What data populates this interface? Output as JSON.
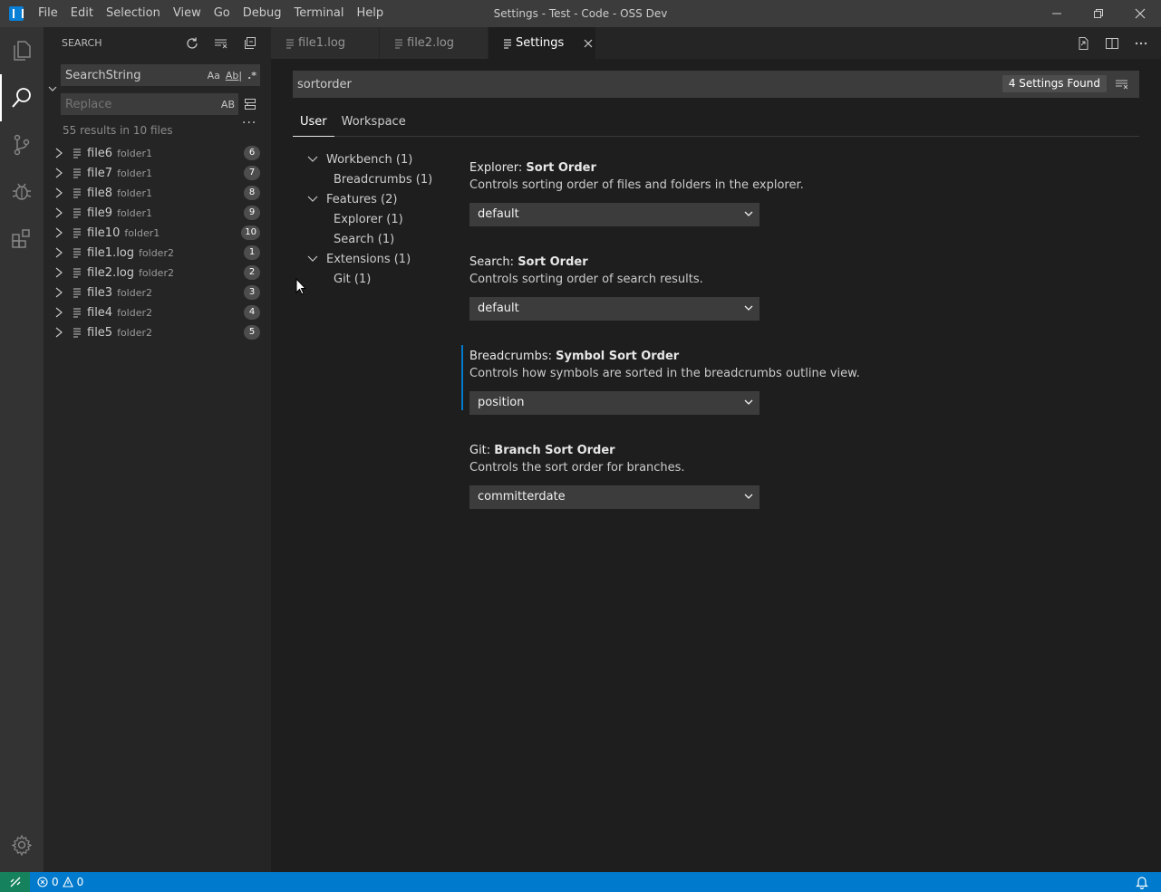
{
  "window": {
    "title": "Settings - Test - Code - OSS Dev",
    "menu": [
      "File",
      "Edit",
      "Selection",
      "View",
      "Go",
      "Debug",
      "Terminal",
      "Help"
    ]
  },
  "activity": [
    "files-icon",
    "search-icon",
    "source-control-icon",
    "debug-icon",
    "extensions-icon",
    "gear-icon"
  ],
  "sidebar": {
    "title": "SEARCH",
    "search_value": "SearchString",
    "search_options": {
      "case": "Aa",
      "word": "Ab|",
      "regex": ".*"
    },
    "replace_placeholder": "Replace",
    "replace_option": "AB",
    "more": "···",
    "summary": "55 results in 10 files",
    "results": [
      {
        "name": "file6",
        "folder": "folder1",
        "count": "6"
      },
      {
        "name": "file7",
        "folder": "folder1",
        "count": "7"
      },
      {
        "name": "file8",
        "folder": "folder1",
        "count": "8"
      },
      {
        "name": "file9",
        "folder": "folder1",
        "count": "9"
      },
      {
        "name": "file10",
        "folder": "folder1",
        "count": "10"
      },
      {
        "name": "file1.log",
        "folder": "folder2",
        "count": "1"
      },
      {
        "name": "file2.log",
        "folder": "folder2",
        "count": "2"
      },
      {
        "name": "file3",
        "folder": "folder2",
        "count": "3"
      },
      {
        "name": "file4",
        "folder": "folder2",
        "count": "4"
      },
      {
        "name": "file5",
        "folder": "folder2",
        "count": "5"
      }
    ]
  },
  "tabs": [
    {
      "label": "file1.log"
    },
    {
      "label": "file2.log"
    },
    {
      "label": "Settings"
    }
  ],
  "settings": {
    "query": "sortorder",
    "found": "4 Settings Found",
    "scopes": [
      "User",
      "Workspace"
    ],
    "toc": [
      {
        "label": "Workbench (1)",
        "level": 0
      },
      {
        "label": "Breadcrumbs (1)",
        "level": 1
      },
      {
        "label": "Features (2)",
        "level": 0
      },
      {
        "label": "Explorer (1)",
        "level": 1
      },
      {
        "label": "Search (1)",
        "level": 1
      },
      {
        "label": "Extensions (1)",
        "level": 0
      },
      {
        "label": "Git (1)",
        "level": 1
      }
    ],
    "items": [
      {
        "category": "Explorer: ",
        "key": "Sort Order",
        "description": "Controls sorting order of files and folders in the explorer.",
        "value": "default"
      },
      {
        "category": "Search: ",
        "key": "Sort Order",
        "description": "Controls sorting order of search results.",
        "value": "default"
      },
      {
        "category": "Breadcrumbs: ",
        "key": "Symbol Sort Order",
        "description": "Controls how symbols are sorted in the breadcrumbs outline view.",
        "value": "position"
      },
      {
        "category": "Git: ",
        "key": "Branch Sort Order",
        "description": "Controls the sort order for branches.",
        "value": "committerdate"
      }
    ]
  },
  "status": {
    "errors": "0",
    "warnings": "0"
  },
  "colors": {
    "accent": "#007acc",
    "remote": "#16825d"
  }
}
